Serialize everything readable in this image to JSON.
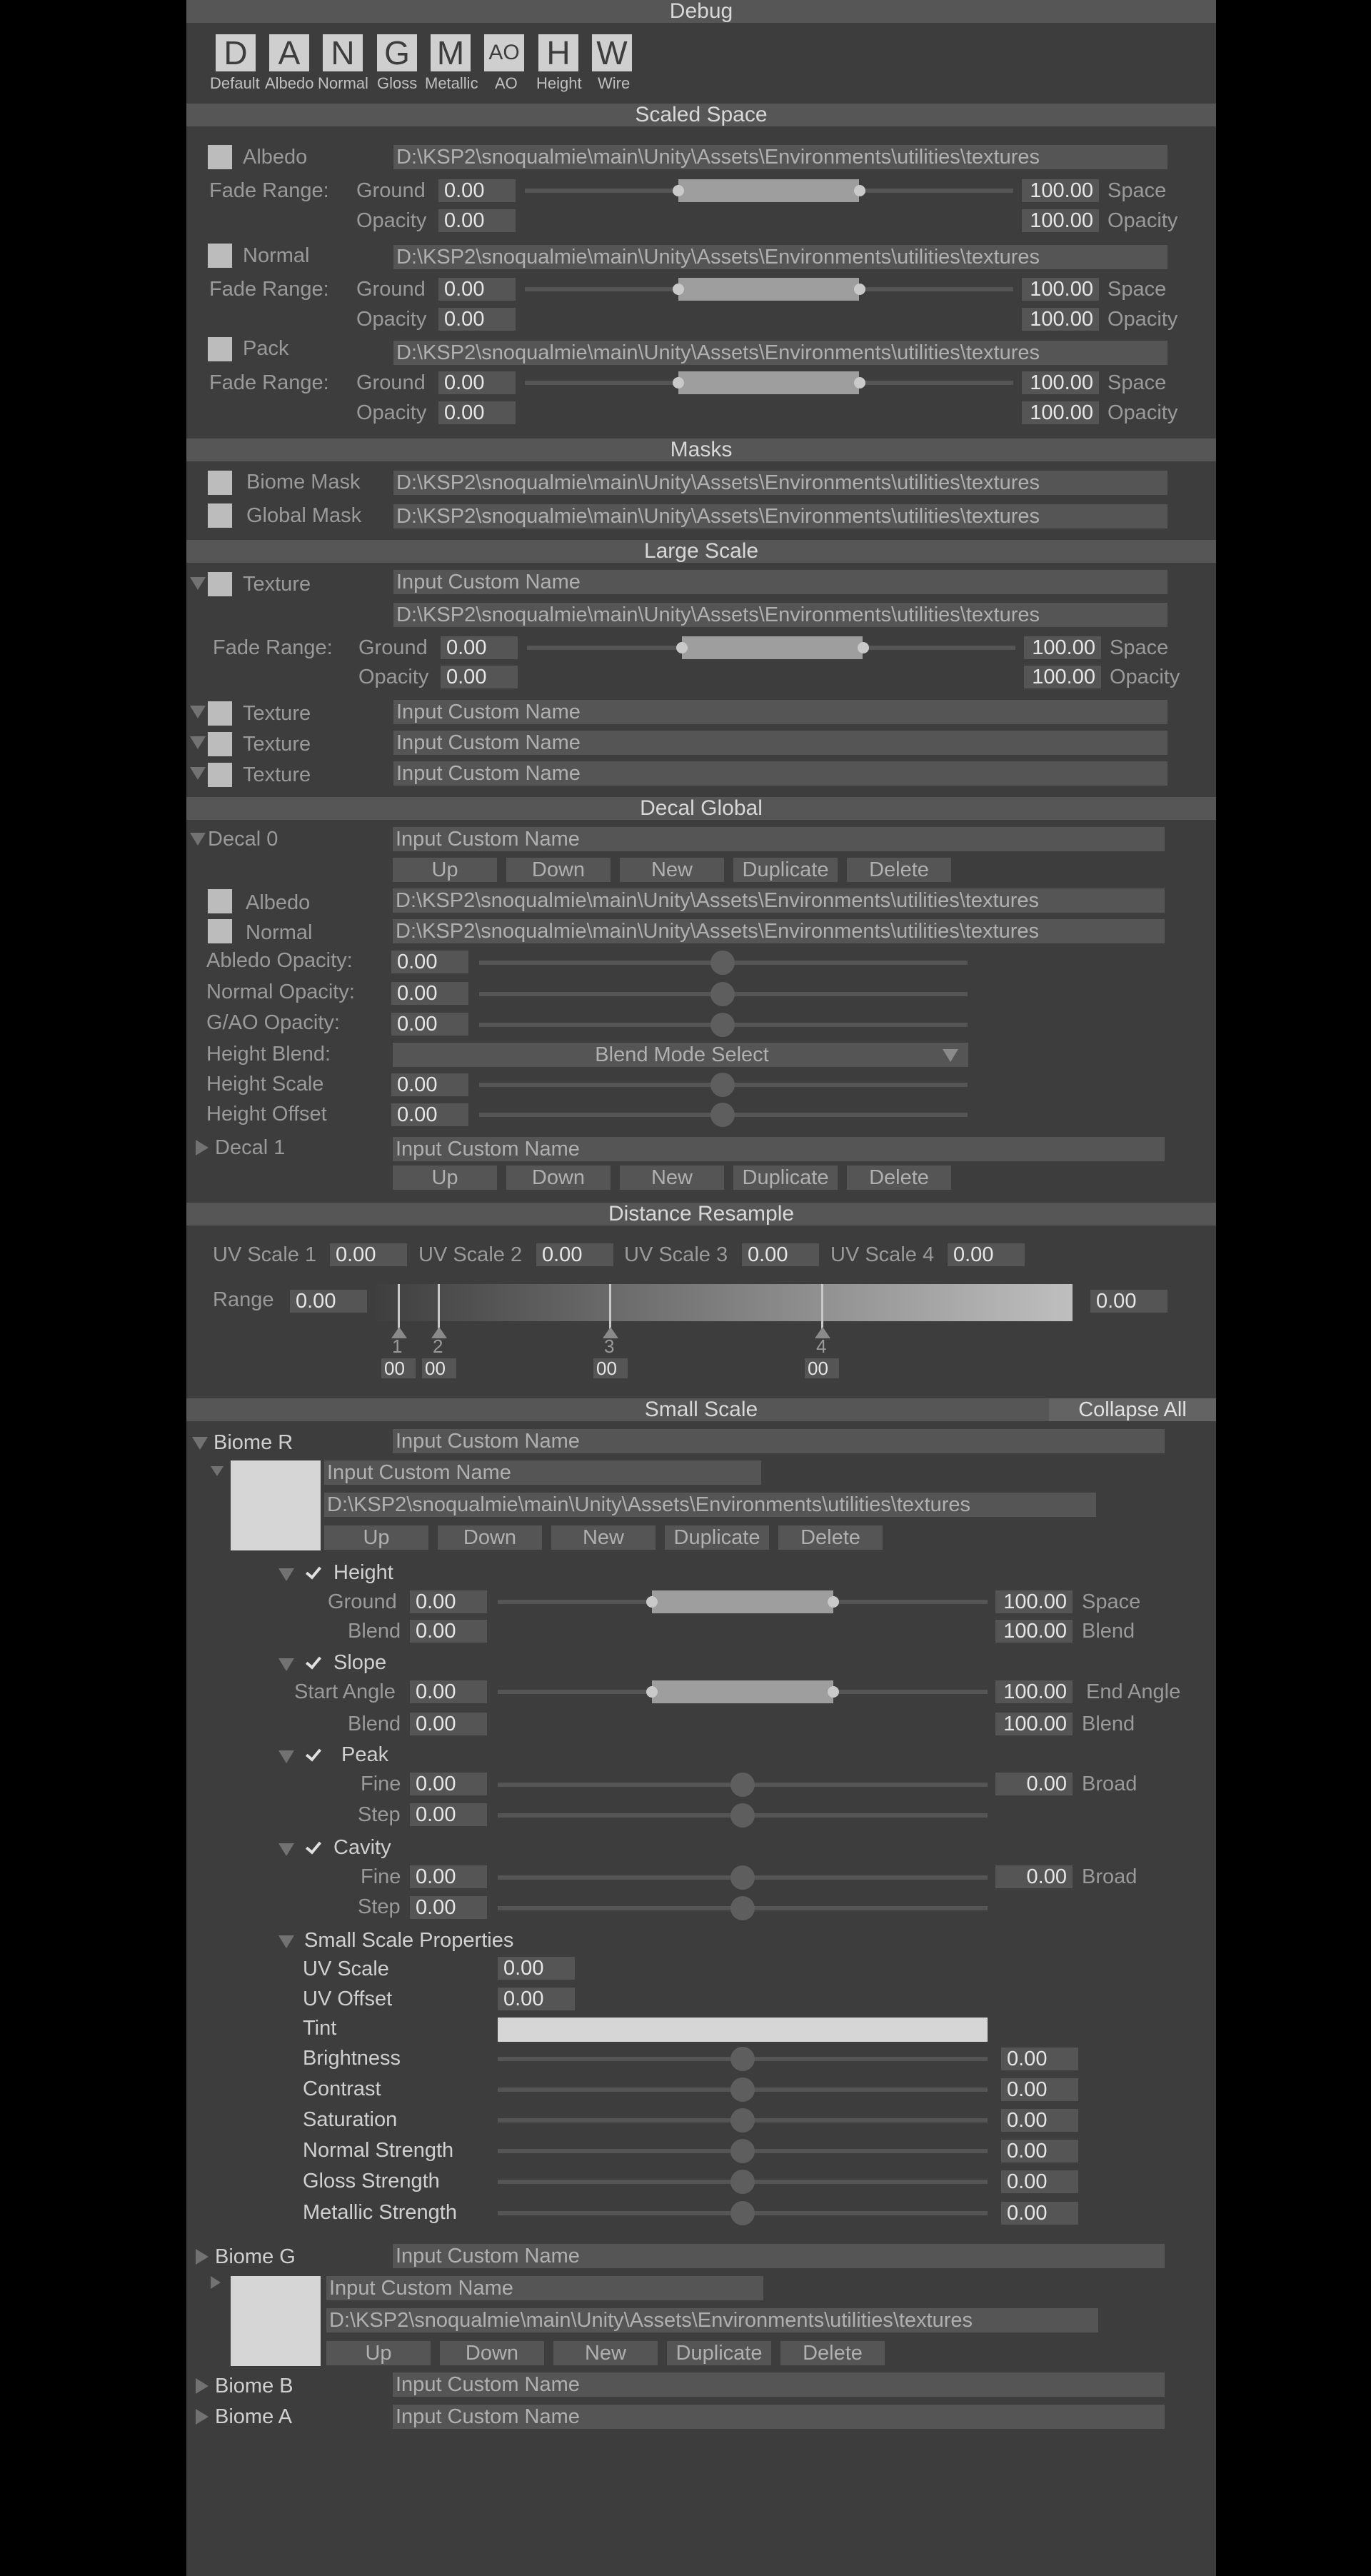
{
  "debug": {
    "title": "Debug",
    "buttons": [
      {
        "glyph": "D",
        "label": "Default"
      },
      {
        "glyph": "A",
        "label": "Albedo"
      },
      {
        "glyph": "N",
        "label": "Normal"
      },
      {
        "glyph": "G",
        "label": "Gloss"
      },
      {
        "glyph": "M",
        "label": "Metallic"
      },
      {
        "glyph": "AO",
        "label": "AO"
      },
      {
        "glyph": "H",
        "label": "Height"
      },
      {
        "glyph": "W",
        "label": "Wire"
      }
    ]
  },
  "common": {
    "path": "D:\\KSP2\\snoqualmie\\main\\Unity\\Assets\\Environments\\utilities\\textures",
    "zero": "0.00",
    "hundred": "100.00",
    "custom_name": "Input Custom Name",
    "fade_range": "Fade Range:",
    "ground": "Ground",
    "opacity": "Opacity",
    "space": "Space",
    "blend": "Blend",
    "broad": "Broad",
    "fine": "Fine",
    "step": "Step",
    "texture": "Texture",
    "btn_up": "Up",
    "btn_down": "Down",
    "btn_new": "New",
    "btn_duplicate": "Duplicate",
    "btn_delete": "Delete",
    "small_zero": "00"
  },
  "scaled_space": {
    "title": "Scaled Space",
    "albedo": "Albedo",
    "normal": "Normal",
    "pack": "Pack"
  },
  "masks": {
    "title": "Masks",
    "biome_mask": "Biome Mask",
    "global_mask": "Global Mask"
  },
  "large_scale": {
    "title": "Large Scale"
  },
  "decal_global": {
    "title": "Decal Global",
    "decal0": "Decal 0",
    "decal1": "Decal 1",
    "albedo": "Albedo",
    "normal": "Normal",
    "albedo_opacity": "Abledo Opacity:",
    "normal_opacity": "Normal Opacity:",
    "gao_opacity": "G/AO Opacity:",
    "height_blend": "Height Blend:",
    "blend_mode": "Blend Mode Select",
    "height_scale": "Height Scale",
    "height_offset": "Height Offset"
  },
  "distance_resample": {
    "title": "Distance Resample",
    "uv1": "UV Scale 1",
    "uv2": "UV Scale 2",
    "uv3": "UV Scale 3",
    "uv4": "UV Scale 4",
    "range": "Range",
    "markers": [
      "1",
      "2",
      "3",
      "4"
    ]
  },
  "small_scale": {
    "title": "Small Scale",
    "collapse_all": "Collapse All",
    "biome_r": "Biome R",
    "biome_g": "Biome G",
    "biome_b": "Biome B",
    "biome_a": "Biome A",
    "height": "Height",
    "slope": "Slope",
    "peak": "Peak",
    "cavity": "Cavity",
    "start_angle": "Start Angle",
    "end_angle": "End Angle",
    "properties": "Small Scale Properties",
    "uv_scale": "UV Scale",
    "uv_offset": "UV Offset",
    "tint": "Tint",
    "brightness": "Brightness",
    "contrast": "Contrast",
    "saturation": "Saturation",
    "normal_strength": "Normal Strength",
    "gloss_strength": "Gloss Strength",
    "metallic_strength": "Metallic Strength"
  }
}
